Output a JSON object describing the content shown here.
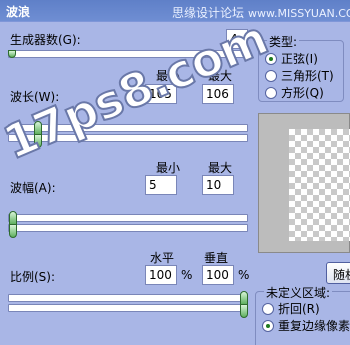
{
  "window": {
    "title": "波浪"
  },
  "site_watermark": {
    "text": "思缘设计论坛",
    "url": "www.MISSYUAN.COM"
  },
  "generators": {
    "label": "生成器数(G):",
    "value": "4"
  },
  "wavelength": {
    "label": "波长(W):",
    "min_label": "最小",
    "max_label": "最大",
    "min_value": "105",
    "max_value": "106"
  },
  "amplitude": {
    "label": "波幅(A):",
    "min_label": "最小",
    "max_label": "最大",
    "min_value": "5",
    "max_value": "10"
  },
  "scale": {
    "label": "比例(S):",
    "horizontal_label": "水平",
    "vertical_label": "垂直",
    "horizontal_value": "100",
    "vertical_value": "100",
    "unit": "%"
  },
  "type_group": {
    "legend": "类型:",
    "options": [
      "正弦(I)",
      "三角形(T)",
      "方形(Q)"
    ],
    "selected": 0
  },
  "undefined_area": {
    "legend": "未定义区域:",
    "options": [
      "折回(R)",
      "重复边缘像素"
    ],
    "selected": 1
  },
  "randomize_button": {
    "label": "随机化"
  },
  "overlay_watermark": {
    "text": "17ps8.com"
  },
  "colors": {
    "dialog_bg": "#a9b6e6",
    "title_bar": "#6381c9",
    "thumb": "#5fb05f"
  }
}
